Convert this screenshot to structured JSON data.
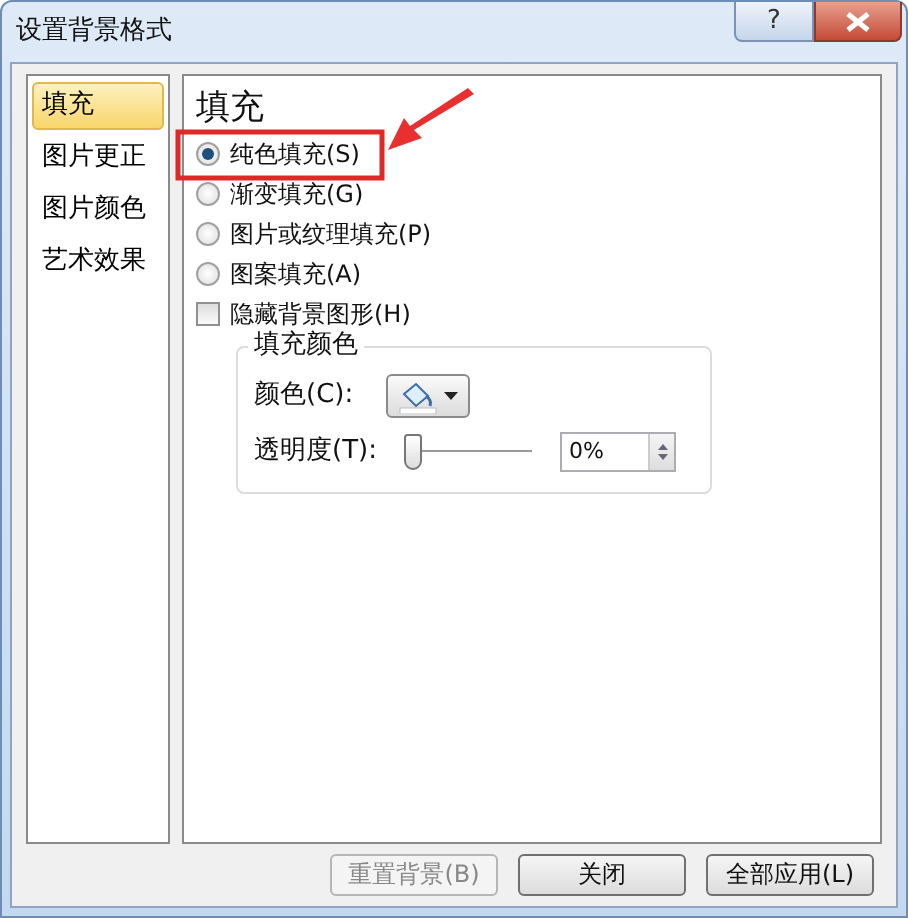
{
  "window": {
    "title": "设置背景格式",
    "help": "?"
  },
  "sidebar": {
    "items": [
      {
        "label": "填充",
        "selected": true
      },
      {
        "label": "图片更正",
        "selected": false
      },
      {
        "label": "图片颜色",
        "selected": false
      },
      {
        "label": "艺术效果",
        "selected": false
      }
    ]
  },
  "panel": {
    "heading": "填充",
    "options": [
      {
        "kind": "radio",
        "label": "纯色填充(S)",
        "selected": true
      },
      {
        "kind": "radio",
        "label": "渐变填充(G)",
        "selected": false
      },
      {
        "kind": "radio",
        "label": "图片或纹理填充(P)",
        "selected": false
      },
      {
        "kind": "radio",
        "label": "图案填充(A)",
        "selected": false
      },
      {
        "kind": "checkbox",
        "label": "隐藏背景图形(H)",
        "checked": false
      }
    ],
    "fill_color": {
      "title": "填充颜色",
      "color_label": "颜色(C):",
      "transparency_label": "透明度(T):",
      "transparency": {
        "level": 0,
        "value": "0%"
      }
    }
  },
  "buttons": [
    {
      "label": "重置背景(B)",
      "disabled": true
    },
    {
      "label": "关闭",
      "disabled": false
    },
    {
      "label": "全部应用(L)",
      "disabled": false
    }
  ]
}
